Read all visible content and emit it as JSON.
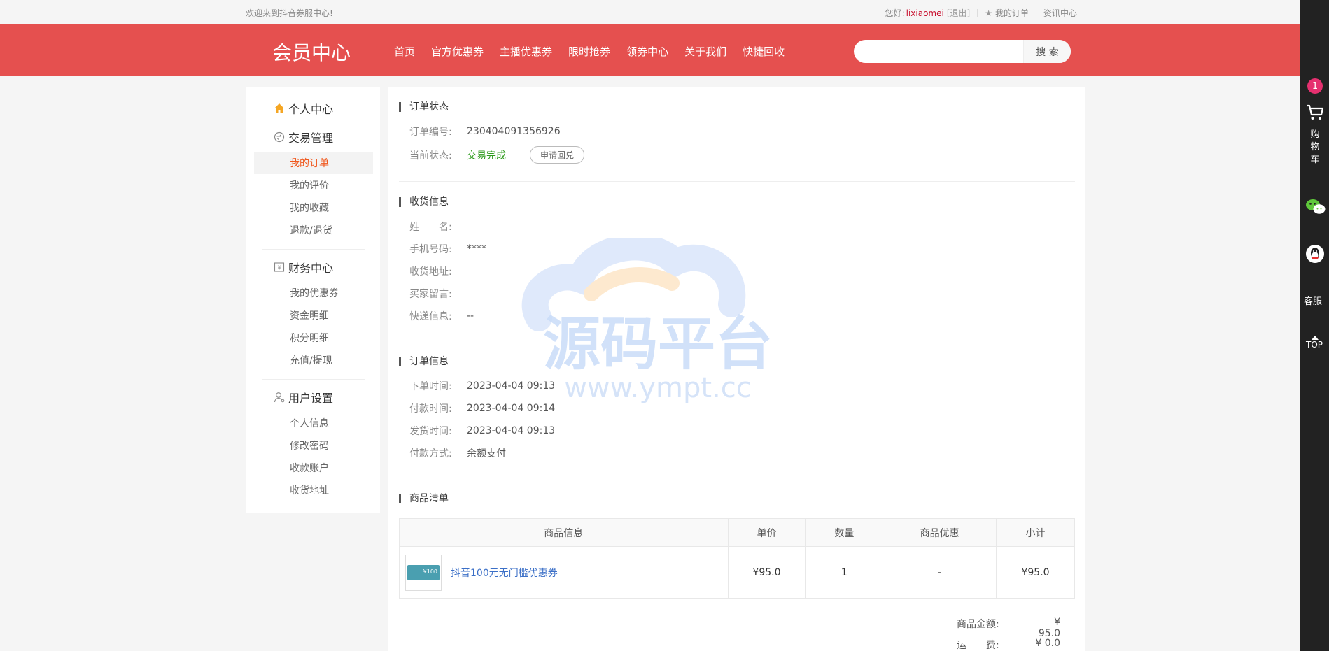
{
  "topbar": {
    "welcome": "欢迎来到抖音券服中心!",
    "greeting": "您好:",
    "username": "lixiaomei",
    "logout": "[退出]",
    "orders": "我的订单",
    "news": "资讯中心"
  },
  "header": {
    "logo": "会员中心",
    "nav": [
      "首页",
      "官方优惠券",
      "主播优惠券",
      "限时抢券",
      "领券中心",
      "关于我们",
      "快捷回收"
    ],
    "search_button": "搜 索",
    "search_value": ""
  },
  "sidebar": {
    "groups": [
      {
        "title": "个人中心",
        "icon": "home-icon"
      },
      {
        "title": "交易管理",
        "icon": "exchange-icon",
        "items": [
          "我的订单",
          "我的评价",
          "我的收藏",
          "退款/退货"
        ]
      },
      {
        "title": "财务中心",
        "icon": "finance-icon",
        "items": [
          "我的优惠券",
          "资金明细",
          "积分明细",
          "充值/提现"
        ]
      },
      {
        "title": "用户设置",
        "icon": "user-icon",
        "items": [
          "个人信息",
          "修改密码",
          "收款账户",
          "收货地址"
        ]
      }
    ],
    "active_item": "我的订单"
  },
  "order_status": {
    "title": "订单状态",
    "order_no_label": "订单编号:",
    "order_no": "230404091356926",
    "status_label": "当前状态:",
    "status": "交易完成",
    "apply_button": "申请回兑"
  },
  "shipping": {
    "title": "收货信息",
    "name_label": "姓　　名:",
    "name": "",
    "phone_label": "手机号码:",
    "phone": "****",
    "address_label": "收货地址:",
    "address": "",
    "message_label": "买家留言:",
    "message": "",
    "express_label": "快递信息:",
    "express": "--"
  },
  "order_info": {
    "title": "订单信息",
    "order_time_label": "下单时间:",
    "order_time": "2023-04-04 09:13",
    "pay_time_label": "付款时间:",
    "pay_time": "2023-04-04 09:14",
    "ship_time_label": "发货时间:",
    "ship_time": "2023-04-04 09:13",
    "pay_method_label": "付款方式:",
    "pay_method": "余额支付"
  },
  "goods": {
    "title": "商品清单",
    "columns": [
      "商品信息",
      "单价",
      "数量",
      "商品优惠",
      "小计"
    ],
    "rows": [
      {
        "name": "抖音100元无门槛优惠券",
        "price": "¥95.0",
        "qty": "1",
        "discount": "-",
        "subtotal": "¥95.0",
        "thumb_amount": "¥100"
      }
    ]
  },
  "summary": {
    "goods_total_label": "商品金额:",
    "goods_total": "¥ 95.0",
    "shipping_label": "运　　费:",
    "shipping": "¥ 0.0"
  },
  "watermark": {
    "text": "源码平台",
    "url": "www.ympt.cc"
  },
  "rightbar": {
    "cart_count": "1",
    "cart_label": "购物车",
    "service_label": "客服",
    "top_label": "TOP"
  },
  "colors": {
    "brand_red": "#e5504f",
    "active_orange": "#f0591f",
    "success_green": "#2e9b1d",
    "link_blue": "#3b6fc7"
  }
}
